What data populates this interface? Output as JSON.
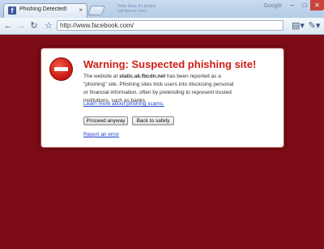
{
  "tab": {
    "title": "Phishing Detected!",
    "favicon_letter": "f",
    "close": "×"
  },
  "tab_strip": {
    "brand": "Google",
    "ghost_line1": "Hello there it's phishy",
    "ghost_line2": "but there's more"
  },
  "window_controls": {
    "minimize": "–",
    "maximize": "□",
    "close": "✕"
  },
  "toolbar": {
    "back_icon": "←",
    "forward_icon": "→",
    "reload_icon": "↻",
    "bookmark_icon": "☆",
    "url": "http://www.facebook.com/",
    "page_menu_icon": "▤▾",
    "wrench_menu_icon": "✎▾"
  },
  "warning": {
    "heading": "Warning: Suspected phishing site!",
    "desc_prefix": "The website at ",
    "site": "static.ak.fbcdn.net",
    "desc_suffix": " has been reported as a \"phishing\" site. Phishing sites trick users into disclosing personal or financial information, often by pretending to represent trusted institutions, such as banks.",
    "learn_more": "Learn more about phishing scams.",
    "proceed_label": "Proceed anyway",
    "back_label": "Back to safety",
    "report_label": "Report an error"
  },
  "colors": {
    "background": "#7d0c16",
    "heading": "#cc1e14",
    "link": "#1a3fcc"
  }
}
